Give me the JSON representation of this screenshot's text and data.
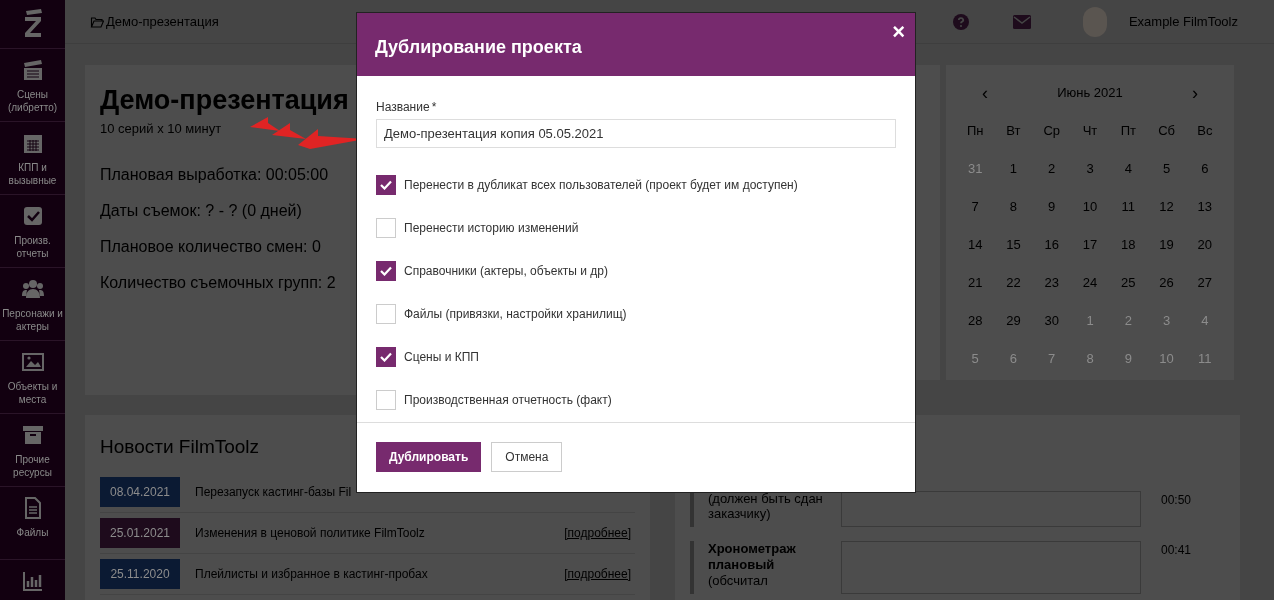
{
  "sidebar": {
    "items": [
      {
        "label": "Сцены (либретто)"
      },
      {
        "label": "КПП и вызывные"
      },
      {
        "label": "Произв. отчеты"
      },
      {
        "label": "Персонажи и актеры"
      },
      {
        "label": "Объекты и места"
      },
      {
        "label": "Прочие ресурсы"
      },
      {
        "label": "Файлы"
      }
    ]
  },
  "topbar": {
    "breadcrumb": "Демо-презентация",
    "user": "Example FilmToolz"
  },
  "project": {
    "title": "Демо-презентация",
    "subtitle": "10 серий x 10 минут",
    "stats": [
      "Плановая выработка: 00:05:00",
      "Даты съемок: ? - ? (0 дней)",
      "Плановое количество смен: 0",
      "Количество съемочных групп: 2"
    ]
  },
  "calendar": {
    "prev": "‹",
    "month": "Июнь 2021",
    "next": "›",
    "weekdays": [
      "Пн",
      "Вт",
      "Ср",
      "Чт",
      "Пт",
      "Сб",
      "Вс"
    ],
    "weeks": [
      [
        {
          "d": "31",
          "other_month": true
        },
        {
          "d": "1",
          "other_month": false
        },
        {
          "d": "2",
          "other_month": false
        },
        {
          "d": "3",
          "other_month": false
        },
        {
          "d": "4",
          "other_month": false
        },
        {
          "d": "5",
          "other_month": false
        },
        {
          "d": "6",
          "other_month": false
        }
      ],
      [
        {
          "d": "7",
          "other_month": false
        },
        {
          "d": "8",
          "other_month": false
        },
        {
          "d": "9",
          "other_month": false
        },
        {
          "d": "10",
          "other_month": false
        },
        {
          "d": "11",
          "other_month": false
        },
        {
          "d": "12",
          "other_month": false
        },
        {
          "d": "13",
          "other_month": false
        }
      ],
      [
        {
          "d": "14",
          "other_month": false
        },
        {
          "d": "15",
          "other_month": false
        },
        {
          "d": "16",
          "other_month": false
        },
        {
          "d": "17",
          "other_month": false
        },
        {
          "d": "18",
          "other_month": false
        },
        {
          "d": "19",
          "other_month": false
        },
        {
          "d": "20",
          "other_month": false
        }
      ],
      [
        {
          "d": "21",
          "other_month": false
        },
        {
          "d": "22",
          "other_month": false
        },
        {
          "d": "23",
          "other_month": false
        },
        {
          "d": "24",
          "other_month": false
        },
        {
          "d": "25",
          "other_month": false
        },
        {
          "d": "26",
          "other_month": false
        },
        {
          "d": "27",
          "other_month": false
        }
      ],
      [
        {
          "d": "28",
          "other_month": false
        },
        {
          "d": "29",
          "other_month": false
        },
        {
          "d": "30",
          "other_month": false
        },
        {
          "d": "1",
          "other_month": true
        },
        {
          "d": "2",
          "other_month": true
        },
        {
          "d": "3",
          "other_month": true
        },
        {
          "d": "4",
          "other_month": true
        }
      ],
      [
        {
          "d": "5",
          "other_month": true
        },
        {
          "d": "6",
          "other_month": true
        },
        {
          "d": "7",
          "other_month": true
        },
        {
          "d": "8",
          "other_month": true
        },
        {
          "d": "9",
          "other_month": true
        },
        {
          "d": "10",
          "other_month": true
        },
        {
          "d": "11",
          "other_month": true
        }
      ]
    ]
  },
  "news": {
    "title": "Новости FilmToolz",
    "items": [
      {
        "date": "08.04.2021",
        "color": "#0b1a33",
        "text": "Перезапуск кастинг-базы Fil"
      },
      {
        "date": "25.01.2021",
        "color": "#1e0b1c",
        "text": "Изменения в ценовой политике FilmToolz",
        "link": "[подробнее]"
      },
      {
        "date": "25.11.2020",
        "color": "#0b1a33",
        "text": "Плейлисты и избранное в кастинг-пробах",
        "link": "[подробнее]"
      }
    ]
  },
  "timing": {
    "rows": [
      {
        "note": "(должен быть сдан заказчику)",
        "time": "00:50"
      },
      {
        "title": "Хронометраж плановый",
        "note": "(обсчитал",
        "time": "00:41"
      }
    ]
  },
  "dialog": {
    "title": "Дублирование проекта",
    "close": "×",
    "name_label": "Название",
    "required_mark": "*",
    "name_value": "Демо-презентация копия 05.05.2021",
    "options": [
      {
        "label": "Перенести в дубликат всех пользователей (проект будет им доступен)",
        "checked": true
      },
      {
        "label": "Перенести историю изменений",
        "checked": false
      },
      {
        "label": "Справочники (актеры, объекты и др)",
        "checked": true
      },
      {
        "label": "Файлы (привязки, настройки хранилищ)",
        "checked": false
      },
      {
        "label": "Сцены и КПП",
        "checked": true
      },
      {
        "label": "Производственная отчетность (факт)",
        "checked": false
      }
    ],
    "buttons": [
      {
        "label": "Дублировать",
        "kind": "primary"
      },
      {
        "label": "Отмена",
        "kind": "secondary"
      }
    ]
  }
}
